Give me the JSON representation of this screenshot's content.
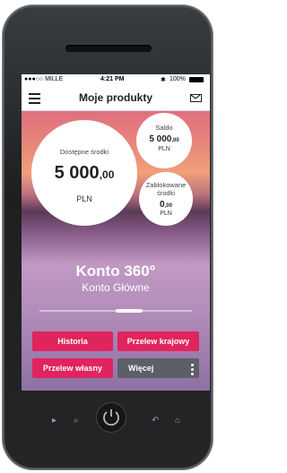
{
  "status_bar": {
    "carrier": "●●●○○ MILLE",
    "time": "4:21 PM",
    "battery": "100%"
  },
  "navbar": {
    "title": "Moje produkty"
  },
  "available": {
    "label": "Dostępne środki",
    "amount": "5 000",
    "decimals": ",00",
    "currency": "PLN"
  },
  "balance": {
    "label": "Saldo",
    "amount": "5 000",
    "decimals": ",00",
    "currency": "PLN"
  },
  "blocked": {
    "label": "Zablokowane środki",
    "amount": "0",
    "decimals": ",00",
    "currency": "PLN"
  },
  "account": {
    "title": "Konto 360°",
    "subtitle": "Konto Główne"
  },
  "buttons": {
    "history": "Historia",
    "domestic_transfer": "Przelew krajowy",
    "own_transfer": "Przelew własny",
    "more": "Więcej"
  },
  "colors": {
    "primary": "#e0245e",
    "secondary": "#5d5f66"
  }
}
